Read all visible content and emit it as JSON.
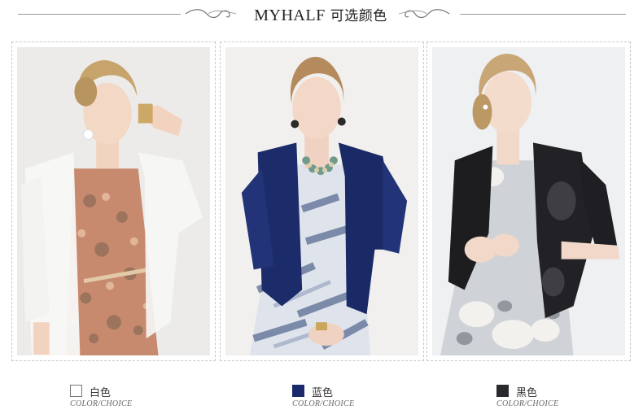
{
  "header": {
    "brand": "MYHALF",
    "subtitle": "可选颜色"
  },
  "products": [
    {
      "id": "white",
      "alt": "White cardigan model photo"
    },
    {
      "id": "navy",
      "alt": "Navy cardigan model photo"
    },
    {
      "id": "black",
      "alt": "Black cardigan model photo"
    }
  ],
  "colors": [
    {
      "name": "白色",
      "sub": "COLOR/CHOICE",
      "hex": "#ffffff"
    },
    {
      "name": "蓝色",
      "sub": "COLOR/CHOICE",
      "hex": "#1a2b6d"
    },
    {
      "name": "黑色",
      "sub": "COLOR/CHOICE",
      "hex": "#2a2a2e"
    }
  ]
}
